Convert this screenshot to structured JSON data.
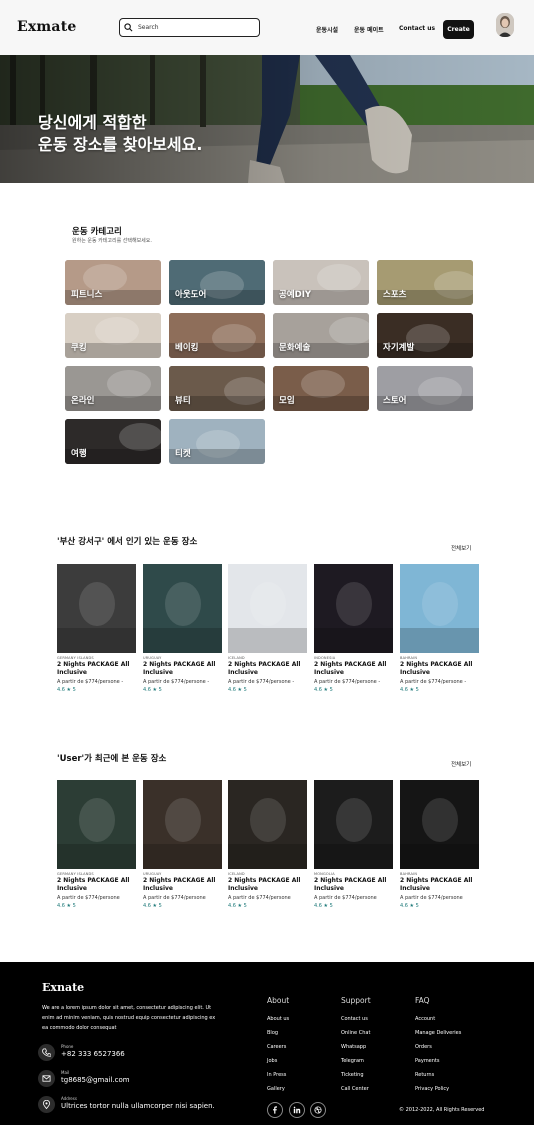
{
  "header": {
    "logo": "Exmate",
    "search_placeholder": "Search",
    "nav": [
      "운동시설",
      "운동 메이트",
      "Contact us"
    ],
    "create_label": "Create"
  },
  "hero": {
    "line1": "당신에게 적합한",
    "line2": "운동 장소를 찾아보세요."
  },
  "category": {
    "title": "운동 카테고리",
    "subtitle": "원하는 운동 카테고리를 선택해보세요.",
    "items": [
      {
        "label": "피트니스",
        "color": "#b59a88"
      },
      {
        "label": "아웃도어",
        "color": "#4f6b75"
      },
      {
        "label": "공예DIY",
        "color": "#c9c2bb"
      },
      {
        "label": "스포츠",
        "color": "#a69b72"
      },
      {
        "label": "쿠킹",
        "color": "#d8cfc4"
      },
      {
        "label": "베이킹",
        "color": "#8e6e5a"
      },
      {
        "label": "문화예술",
        "color": "#a7a19b"
      },
      {
        "label": "자기계발",
        "color": "#3a2d24"
      },
      {
        "label": "온라인",
        "color": "#9a9793"
      },
      {
        "label": "뷰티",
        "color": "#6b5a4b"
      },
      {
        "label": "모임",
        "color": "#7a5d4a"
      },
      {
        "label": "스토어",
        "color": "#9e9ea3"
      },
      {
        "label": "여행",
        "color": "#2d2a29"
      },
      {
        "label": "티켓",
        "color": "#9fb2bf"
      }
    ]
  },
  "popular": {
    "title": "'부산 강서구' 에서 인기 있는 운동 장소",
    "view_all": "전체보기",
    "cards": [
      {
        "country": "GERMANY ISLANDS",
        "title": "2 Nights PACKAGE All Inclusive",
        "price": "A partir de $774/persone -",
        "rating": "4.6 ★ 5",
        "bg": "#3c3c3c"
      },
      {
        "country": "URUGUAY",
        "title": "2 Nights PACKAGE All Inclusive",
        "price": "A partir de $774/persone -",
        "rating": "4.6 ★ 5",
        "bg": "#2f4a4a"
      },
      {
        "country": "ICELAND",
        "title": "2 Nights PACKAGE All Inclusive",
        "price": "A partir de $774/persone -",
        "rating": "4.6 ★ 5",
        "bg": "#e3e6ea"
      },
      {
        "country": "INDONESIA",
        "title": "2 Nights PACKAGE All Inclusive",
        "price": "A partir de $774/persone -",
        "rating": "4.6 ★ 5",
        "bg": "#1e1a22"
      },
      {
        "country": "BAHRAIN",
        "title": "2 Nights PACKAGE All Inclusive",
        "price": "A partir de $774/persone -",
        "rating": "4.6 ★ 5",
        "bg": "#7fb6d5"
      }
    ]
  },
  "recent": {
    "title": "'User'가 최근에 본 운동 장소",
    "view_all": "전체보기",
    "cards": [
      {
        "country": "GERMANY ISLANDS",
        "title": "2 Nights PACKAGE All Inclusive",
        "price": "A partir de $774/persone",
        "rating": "4.6 ★ 5",
        "bg": "#2c3d35"
      },
      {
        "country": "URUGUAY",
        "title": "2 Nights PACKAGE All Inclusive",
        "price": "A partir de $774/persone",
        "rating": "4.6 ★ 5",
        "bg": "#3a3029"
      },
      {
        "country": "ICELAND",
        "title": "2 Nights PACKAGE All Inclusive",
        "price": "A partir de $774/persone",
        "rating": "4.6 ★ 5",
        "bg": "#2a2622"
      },
      {
        "country": "MONGOLIA",
        "title": "2 Nights PACKAGE All Inclusive",
        "price": "A partir de $774/persone",
        "rating": "4.6 ★ 5",
        "bg": "#1c1c1c"
      },
      {
        "country": "BAHRAIN",
        "title": "2 Nights PACKAGE All Inclusive",
        "price": "A partir de $774/persone",
        "rating": "4.6 ★ 5",
        "bg": "#151515"
      }
    ]
  },
  "footer": {
    "logo": "Exnate",
    "description": "We are a lorem ipsum dolor sit amet, consectetur adipiscing elit. Ut enim ad minim veniam, quis nostrud equip consectetur adipiscing ex ea commodo dolor consequat",
    "phone_label": "Phone",
    "phone": "+82 333 6527366",
    "email_label": "Mail",
    "email": "tg8685@gmail.com",
    "address_label": "Address",
    "address": "Ultrices tortor nulla ullamcorper nisi sapien.",
    "columns": [
      {
        "head": "About",
        "links": [
          "About us",
          "Blog",
          "Careers",
          "Jobs",
          "In Press",
          "Gallery"
        ]
      },
      {
        "head": "Support",
        "links": [
          "Contact us",
          "Online Chat",
          "Whatsapp",
          "Telegram",
          "Ticketing",
          "Call Center"
        ]
      },
      {
        "head": "FAQ",
        "links": [
          "Account",
          "Manage Deliveries",
          "Orders",
          "Payments",
          "Returns",
          "Privacy Policy"
        ]
      }
    ],
    "copyright": "© 2012-2022, All Rights Reserved"
  }
}
